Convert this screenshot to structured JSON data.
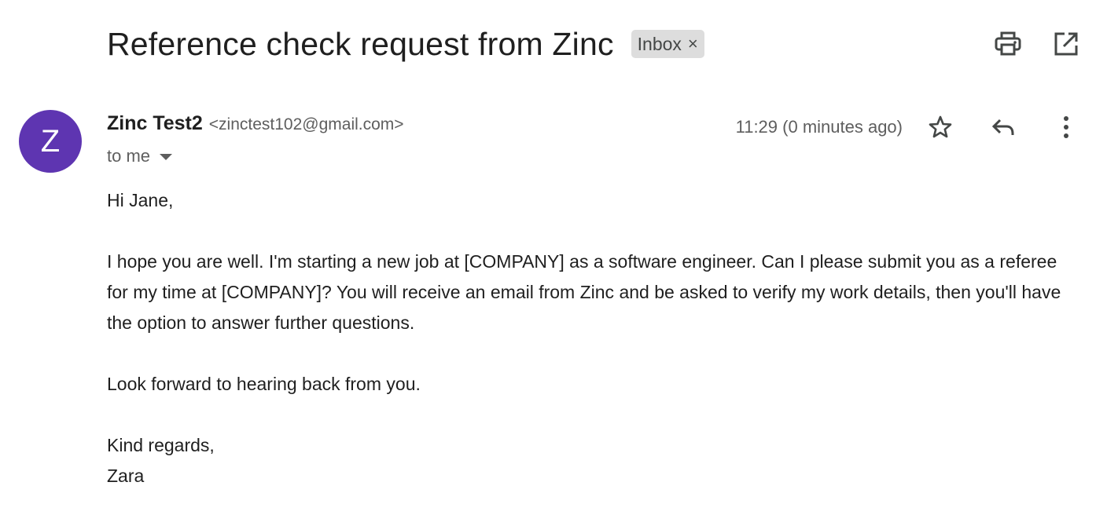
{
  "subject": "Reference check request from Zinc",
  "label": {
    "text": "Inbox",
    "remove": "×"
  },
  "icons": {
    "print": "print-icon",
    "open_new_window": "open-in-new-window-icon",
    "star": "star-icon",
    "reply": "reply-icon",
    "more": "more-vert-icon"
  },
  "sender": {
    "avatar_letter": "Z",
    "avatar_color": "#5e35b1",
    "name": "Zinc Test2",
    "email": "<zinctest102@gmail.com>",
    "recipient": "to me"
  },
  "timestamp": "11:29 (0 minutes ago)",
  "body": {
    "greeting": "Hi Jane,",
    "paragraph": "I hope you are well. I'm starting a new job at [COMPANY] as a software engineer. Can I please submit you as a referee for my time at [COMPANY]? You will receive an email from Zinc and be asked to verify my work details, then you'll have the option to answer further questions.",
    "closing_line": "Look forward to hearing back from you.",
    "signoff": "Kind regards,",
    "signature": "Zara"
  }
}
